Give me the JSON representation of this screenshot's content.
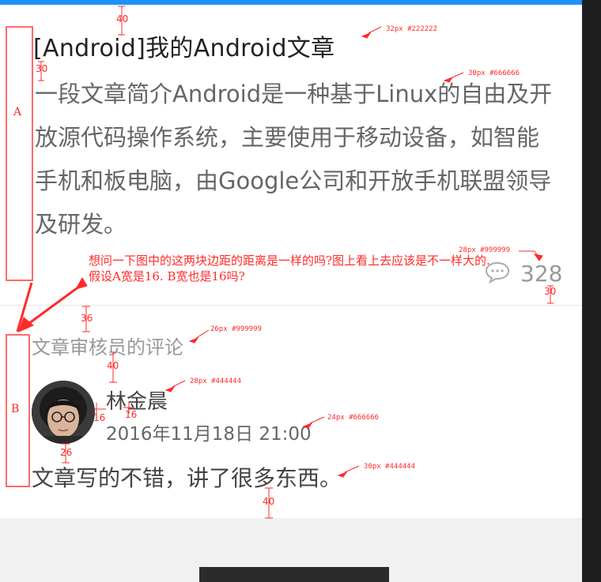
{
  "article": {
    "title": "[Android]我的Android文章",
    "summary": "一段文章简介Android是一种基于Linux的自由及开放源代码操作系统，主要使用于移动设备，如智能手机和板电脑，由Google公司和开放手机联盟领导及研发。",
    "comment_count": "328"
  },
  "review": {
    "section_title": "文章审核员的评论",
    "user_name": "林金晨",
    "timestamp": "2016年11月18日 21:00",
    "comment": "文章写的不错，讲了很多东西。"
  },
  "annotations": {
    "question": "想问一下图中的这两块边距的距离是一样的吗?图上看上去应该是不一样大的. 假设A宽是16. B宽也是16吗?",
    "box_a": "A",
    "box_b": "B",
    "title_spec": "32px  #222222",
    "summary_spec": "30px  #666666",
    "count_spec": "28px #999999",
    "section_spec": "26px #999999",
    "name_spec": "28px #444444",
    "time_spec": "24px #666666",
    "comment_spec": "30px #444444",
    "d40_top": "40",
    "d30_title": "30",
    "d30_count": "30",
    "d36": "36",
    "d40_section": "40",
    "d16_left": "16",
    "d16_right": "16",
    "d26": "26",
    "d40_bottom": "40"
  },
  "colors": {
    "accent": "#1e90ff",
    "annotation": "#ff2a2a"
  },
  "icons": {
    "comment": "speech-bubble-icon"
  }
}
